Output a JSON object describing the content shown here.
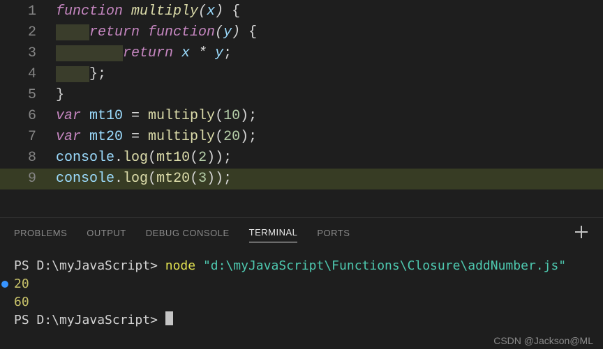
{
  "editor": {
    "current_line": 9,
    "lines": [
      {
        "n": 1,
        "tokens": [
          {
            "t": "function ",
            "c": "kw ital"
          },
          {
            "t": "multiply",
            "c": "fn ital"
          },
          {
            "t": "(",
            "c": "punc ital"
          },
          {
            "t": "x",
            "c": "id ital"
          },
          {
            "t": ")",
            "c": "punc ital"
          },
          {
            "t": " ",
            "c": ""
          },
          {
            "t": "{",
            "c": "punc"
          }
        ]
      },
      {
        "n": 2,
        "tokens": [
          {
            "t": "    ",
            "c": "ws-hl"
          },
          {
            "t": "return ",
            "c": "kw ital"
          },
          {
            "t": "function",
            "c": "kw ital"
          },
          {
            "t": "(",
            "c": "punc ital"
          },
          {
            "t": "y",
            "c": "id ital"
          },
          {
            "t": ")",
            "c": "punc ital"
          },
          {
            "t": " ",
            "c": ""
          },
          {
            "t": "{",
            "c": "punc"
          }
        ]
      },
      {
        "n": 3,
        "tokens": [
          {
            "t": "        ",
            "c": "ws-hl"
          },
          {
            "t": "return ",
            "c": "kw ital"
          },
          {
            "t": "x",
            "c": "id ital"
          },
          {
            "t": " * ",
            "c": "op ital"
          },
          {
            "t": "y",
            "c": "id ital"
          },
          {
            "t": ";",
            "c": "punc"
          }
        ]
      },
      {
        "n": 4,
        "tokens": [
          {
            "t": "    ",
            "c": "ws-hl"
          },
          {
            "t": "};",
            "c": "punc"
          }
        ]
      },
      {
        "n": 5,
        "tokens": [
          {
            "t": "}",
            "c": "punc"
          }
        ]
      },
      {
        "n": 6,
        "tokens": [
          {
            "t": "var ",
            "c": "kw ital"
          },
          {
            "t": "mt10",
            "c": "id"
          },
          {
            "t": " = ",
            "c": "op"
          },
          {
            "t": "multiply",
            "c": "mult"
          },
          {
            "t": "(",
            "c": "punc"
          },
          {
            "t": "10",
            "c": "num"
          },
          {
            "t": ");",
            "c": "punc"
          }
        ]
      },
      {
        "n": 7,
        "tokens": [
          {
            "t": "var ",
            "c": "kw ital"
          },
          {
            "t": "mt20",
            "c": "id"
          },
          {
            "t": " = ",
            "c": "op"
          },
          {
            "t": "multiply",
            "c": "mult"
          },
          {
            "t": "(",
            "c": "punc"
          },
          {
            "t": "20",
            "c": "num"
          },
          {
            "t": ");",
            "c": "punc"
          }
        ]
      },
      {
        "n": 8,
        "tokens": [
          {
            "t": "console",
            "c": "id"
          },
          {
            "t": ".",
            "c": "punc"
          },
          {
            "t": "log",
            "c": "fn"
          },
          {
            "t": "(",
            "c": "punc"
          },
          {
            "t": "mt10",
            "c": "mult"
          },
          {
            "t": "(",
            "c": "punc"
          },
          {
            "t": "2",
            "c": "num"
          },
          {
            "t": "));",
            "c": "punc"
          }
        ]
      },
      {
        "n": 9,
        "tokens": [
          {
            "t": "console",
            "c": "id"
          },
          {
            "t": ".",
            "c": "punc"
          },
          {
            "t": "log",
            "c": "fn"
          },
          {
            "t": "(",
            "c": "punc"
          },
          {
            "t": "mt20",
            "c": "mult"
          },
          {
            "t": "(",
            "c": "punc"
          },
          {
            "t": "3",
            "c": "num"
          },
          {
            "t": "));",
            "c": "punc"
          }
        ]
      }
    ]
  },
  "panel": {
    "tabs": [
      {
        "label": "PROBLEMS",
        "active": false
      },
      {
        "label": "OUTPUT",
        "active": false
      },
      {
        "label": "DEBUG CONSOLE",
        "active": false
      },
      {
        "label": "TERMINAL",
        "active": true
      },
      {
        "label": "PORTS",
        "active": false
      }
    ]
  },
  "terminal": {
    "prompt_prefix": "PS ",
    "cwd": "D:\\myJavaScript",
    "prompt_suffix": "> ",
    "command": "node",
    "argument": "\"d:\\myJavaScript\\Functions\\Closure\\addNumber.js\"",
    "output": [
      "20",
      "60"
    ],
    "marker_line_index": 1
  },
  "watermark": "CSDN @Jackson@ML"
}
